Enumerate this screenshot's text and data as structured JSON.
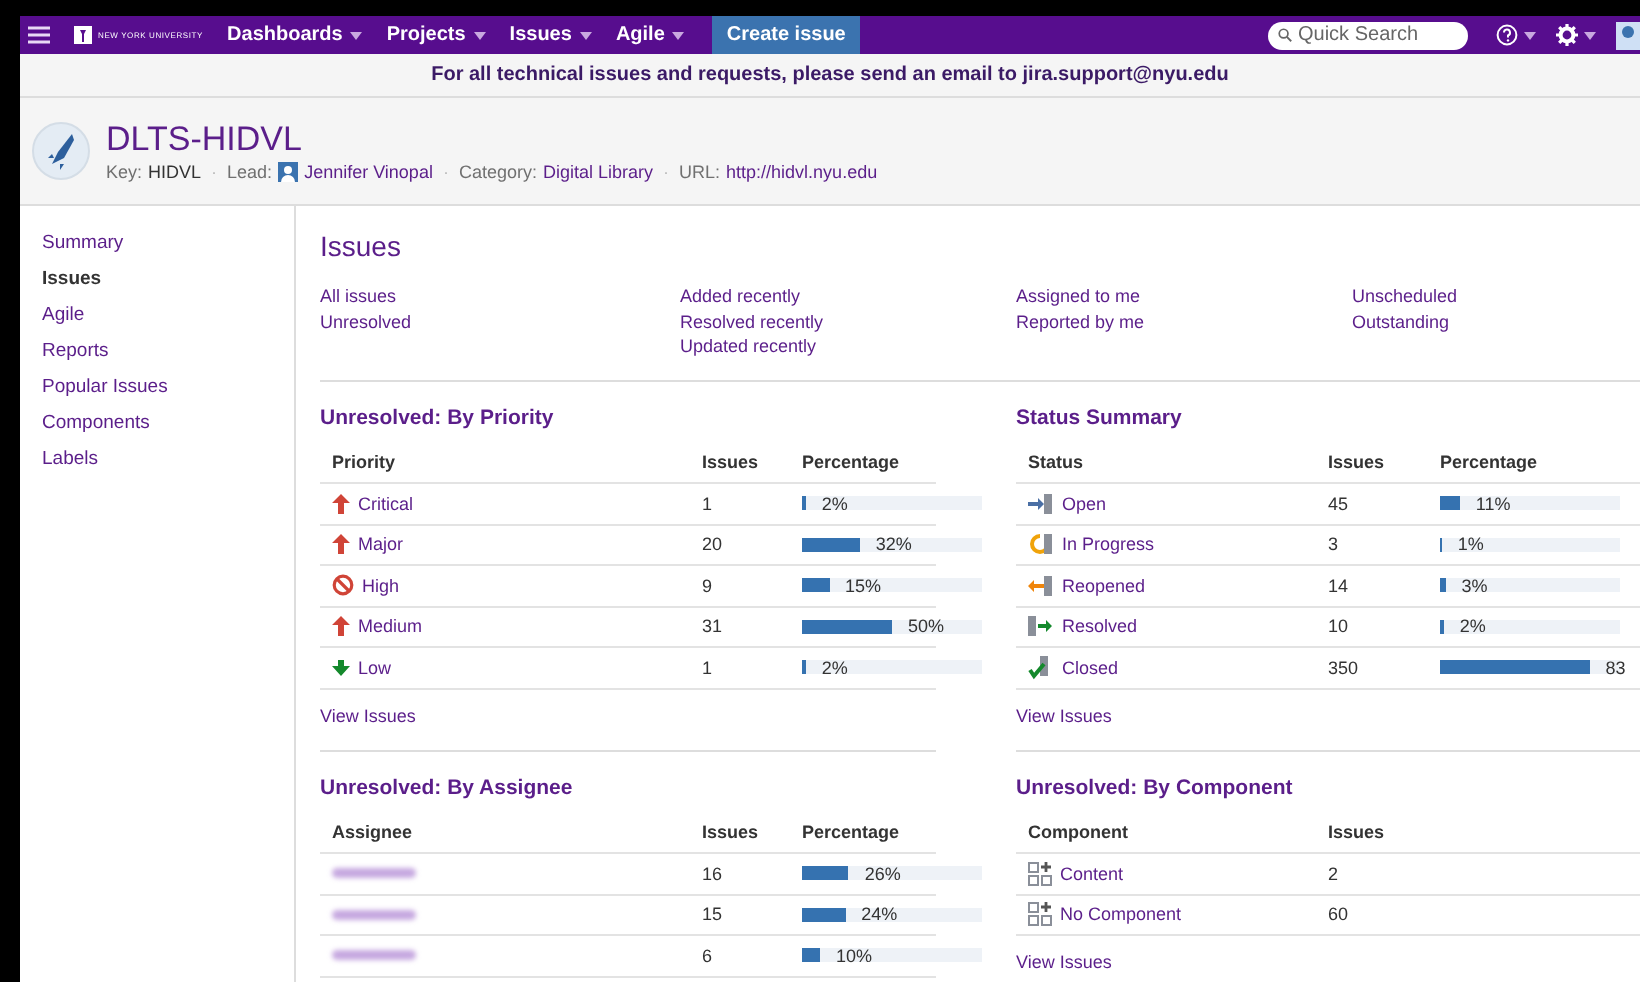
{
  "topbar": {
    "logo_text": "NEW YORK UNIVERSITY",
    "menus": [
      {
        "label": "Dashboards"
      },
      {
        "label": "Projects"
      },
      {
        "label": "Issues"
      },
      {
        "label": "Agile"
      }
    ],
    "create_button": "Create issue",
    "search": {
      "placeholder": "Quick Search"
    }
  },
  "announcement": "For all technical issues and requests, please send an email to jira.support@nyu.edu",
  "project": {
    "name": "DLTS-HIDVL",
    "meta": [
      {
        "label": "Key:",
        "value": "HIDVL",
        "kind": "text"
      },
      {
        "separator": "·",
        "label": "Lead:",
        "value": "Jennifer Vinopal",
        "kind": "user"
      },
      {
        "separator": "·",
        "label": "Category:",
        "value": "Digital Library",
        "kind": "link"
      },
      {
        "separator": "·",
        "label": "URL:",
        "value": "http://hidvl.nyu.edu",
        "kind": "url"
      }
    ]
  },
  "sidebar": {
    "items": [
      {
        "label": "Summary",
        "selected": false
      },
      {
        "label": "Issues",
        "selected": true
      },
      {
        "label": "Agile",
        "selected": false
      },
      {
        "label": "Reports",
        "selected": false
      },
      {
        "label": "Popular Issues",
        "selected": false
      },
      {
        "label": "Components",
        "selected": false
      },
      {
        "label": "Labels",
        "selected": false
      }
    ]
  },
  "issues": {
    "title": "Issues",
    "filter_columns": [
      [
        "All issues",
        "Unresolved"
      ],
      [
        "Added recently",
        "Resolved recently",
        "Updated recently"
      ],
      [
        "Assigned to me",
        "Reported by me"
      ],
      [
        "Unscheduled",
        "Outstanding"
      ]
    ]
  },
  "panels": [
    {
      "title": "Unresolved: By Priority",
      "columns": [
        "Priority",
        "Issues",
        "Percentage"
      ],
      "link": "View Issues",
      "rows": [
        {
          "kind": "up",
          "name": "Critical",
          "issues": "1",
          "percentage": "2%",
          "level": 0.02
        },
        {
          "kind": "up",
          "name": "Major",
          "issues": "20",
          "percentage": "32%",
          "level": 0.32
        },
        {
          "kind": "blocked",
          "name": "High",
          "issues": "9",
          "percentage": "15%",
          "level": 0.15
        },
        {
          "kind": "up",
          "name": "Medium",
          "issues": "31",
          "percentage": "50%",
          "level": 0.5
        },
        {
          "kind": "down",
          "name": "Low",
          "issues": "1",
          "percentage": "2%",
          "level": 0.02
        }
      ]
    },
    {
      "title": "Status Summary",
      "columns": [
        "Status",
        "Issues",
        "Percentage"
      ],
      "link": "View Issues",
      "rows": [
        {
          "kind": "open",
          "name": "Open",
          "issues": "45",
          "percentage": "11%",
          "level": 0.11
        },
        {
          "kind": "progress",
          "name": "In Progress",
          "issues": "3",
          "percentage": "1%",
          "level": 0.01
        },
        {
          "kind": "reopened",
          "name": "Reopened",
          "issues": "14",
          "percentage": "3%",
          "level": 0.03
        },
        {
          "kind": "resolved",
          "name": "Resolved",
          "issues": "10",
          "percentage": "2%",
          "level": 0.02
        },
        {
          "kind": "closed",
          "name": "Closed",
          "issues": "350",
          "percentage": "83",
          "level": 0.83
        }
      ]
    },
    {
      "title": "Unresolved: By Assignee",
      "columns": [
        "Assignee",
        "Issues",
        "Percentage"
      ],
      "rows": [
        {
          "kind": "blurred",
          "issues": "16",
          "percentage": "26%",
          "level": 0.26
        },
        {
          "kind": "blurred",
          "issues": "15",
          "percentage": "24%",
          "level": 0.24
        },
        {
          "kind": "blurred",
          "issues": "6",
          "percentage": "10%",
          "level": 0.1
        }
      ]
    },
    {
      "title": "Unresolved: By Component",
      "columns": [
        "Component",
        "Issues"
      ],
      "link": "View Issues",
      "rows": [
        {
          "kind": "component",
          "name": "Content",
          "issues": "2"
        },
        {
          "kind": "component",
          "name": "No Component",
          "issues": "60"
        }
      ]
    }
  ]
}
